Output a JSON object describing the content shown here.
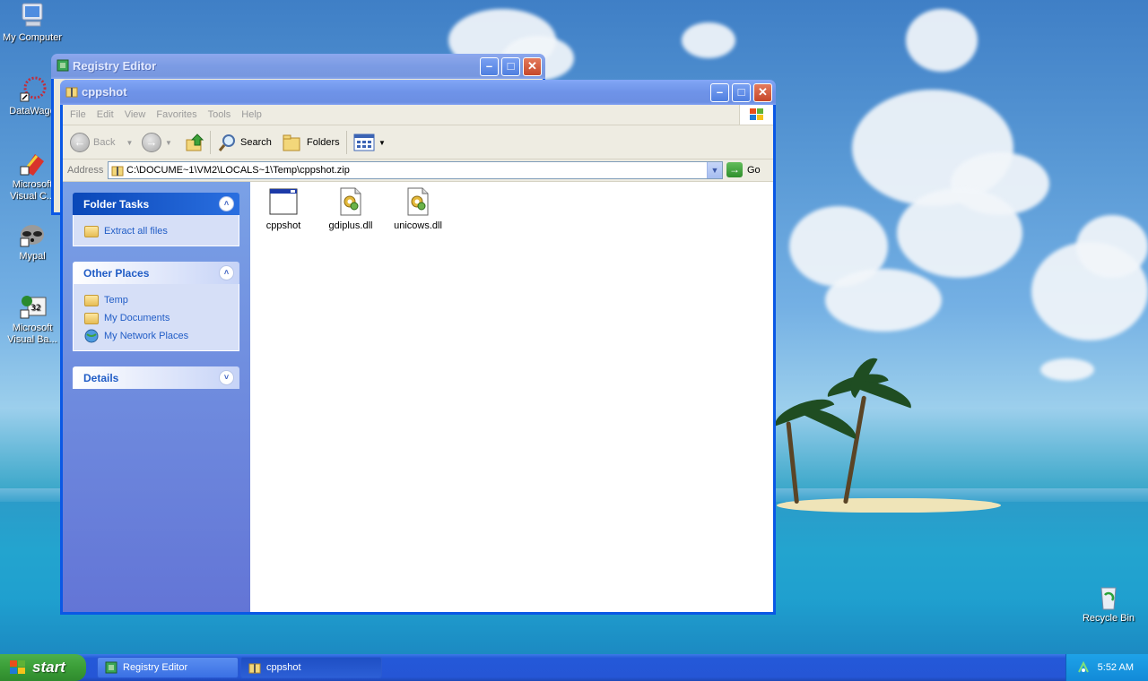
{
  "desktop": {
    "icons": [
      {
        "label": "My Computer"
      },
      {
        "label": "DataWago"
      },
      {
        "label": "Microsoft Visual C..."
      },
      {
        "label": "Mypal"
      },
      {
        "label": "Microsoft Visual Ba..."
      },
      {
        "label": "Recycle Bin"
      }
    ]
  },
  "registry_window": {
    "title": "Registry Editor"
  },
  "explorer": {
    "title": "cppshot",
    "menu": [
      "File",
      "Edit",
      "View",
      "Favorites",
      "Tools",
      "Help"
    ],
    "toolbar": {
      "back": "Back",
      "search": "Search",
      "folders": "Folders"
    },
    "address": {
      "label": "Address",
      "value": "C:\\DOCUME~1\\VM2\\LOCALS~1\\Temp\\cppshot.zip",
      "go": "Go"
    },
    "folder_tasks": {
      "title": "Folder Tasks",
      "items": [
        "Extract all files"
      ]
    },
    "other_places": {
      "title": "Other Places",
      "items": [
        "Temp",
        "My Documents",
        "My Network Places"
      ]
    },
    "details": {
      "title": "Details"
    },
    "files": [
      {
        "name": "cppshot",
        "icon": "application-window-icon"
      },
      {
        "name": "gdiplus.dll",
        "icon": "dll-gear-icon"
      },
      {
        "name": "unicows.dll",
        "icon": "dll-gear-icon"
      }
    ]
  },
  "taskbar": {
    "start": "start",
    "tasks": [
      {
        "label": "Registry Editor"
      },
      {
        "label": "cppshot"
      }
    ],
    "clock": "5:52 AM"
  }
}
